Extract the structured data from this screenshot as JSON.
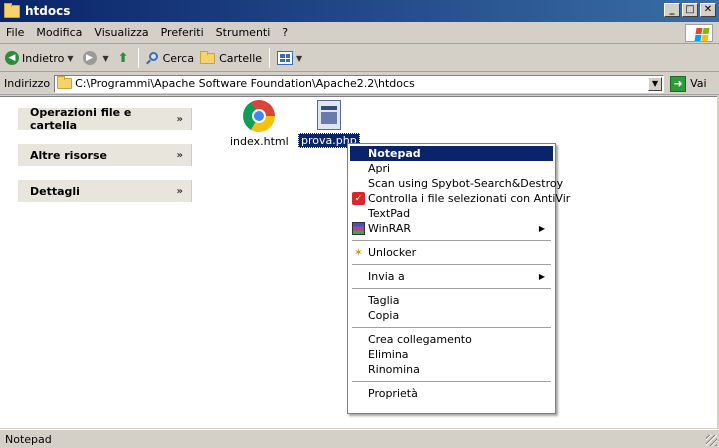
{
  "window": {
    "title": "htdocs"
  },
  "menubar": {
    "items": [
      "File",
      "Modifica",
      "Visualizza",
      "Preferiti",
      "Strumenti",
      "?"
    ]
  },
  "toolbar": {
    "back_label": "Indietro",
    "search_label": "Cerca",
    "folders_label": "Cartelle"
  },
  "addressbar": {
    "label": "Indirizzo",
    "path": "C:\\Programmi\\Apache Software Foundation\\Apache2.2\\htdocs",
    "go_label": "Vai"
  },
  "taskpane": {
    "panels": [
      "Operazioni file e cartella",
      "Altre risorse",
      "Dettagli"
    ]
  },
  "files": [
    {
      "name": "index.html",
      "icon": "chrome-icon",
      "selected": false
    },
    {
      "name": "prova.php",
      "icon": "php-file-icon",
      "selected": true
    }
  ],
  "context_menu": {
    "items": [
      {
        "label": "Notepad",
        "highlighted": true
      },
      {
        "label": "Apri"
      },
      {
        "label": "Scan using Spybot-Search&Destroy"
      },
      {
        "label": "Controlla i file selezionati con AntiVir",
        "icon": "antivir-icon"
      },
      {
        "label": "TextPad"
      },
      {
        "label": "WinRAR",
        "icon": "winrar-icon",
        "submenu": true
      },
      {
        "label": "Unlocker",
        "icon": "unlocker-icon"
      },
      {
        "label": "Invia a",
        "submenu": true
      },
      {
        "label": "Taglia"
      },
      {
        "label": "Copia"
      },
      {
        "label": "Crea collegamento"
      },
      {
        "label": "Elimina"
      },
      {
        "label": "Rinomina"
      },
      {
        "label": "Proprietà"
      }
    ]
  },
  "statusbar": {
    "text": "Notepad"
  }
}
